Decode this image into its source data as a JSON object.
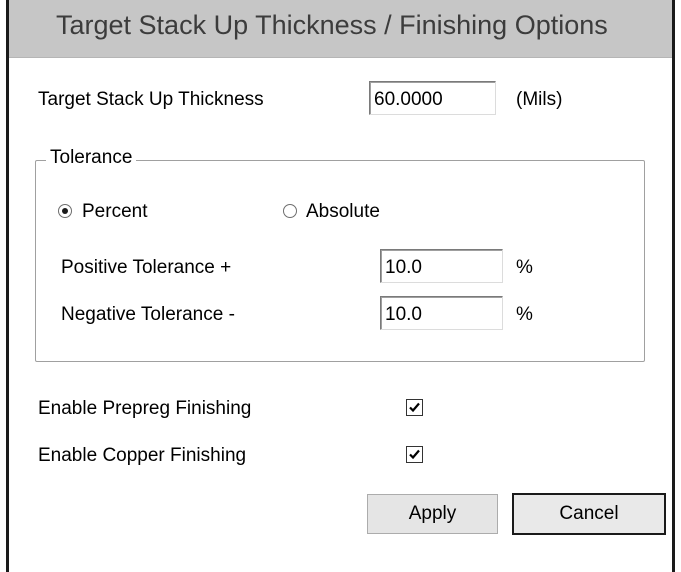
{
  "window": {
    "title": "Target Stack Up Thickness / Finishing Options"
  },
  "thickness": {
    "label": "Target Stack Up Thickness",
    "value": "60.0000",
    "unit": "(Mils)"
  },
  "tolerance": {
    "group_label": "Tolerance",
    "mode_options": [
      {
        "label": "Percent",
        "checked": true
      },
      {
        "label": "Absolute",
        "checked": false
      }
    ],
    "positive": {
      "label": "Positive Tolerance  +",
      "value": "10.0",
      "unit": "%"
    },
    "negative": {
      "label": "Negative Tolerance  -",
      "value": "10.0",
      "unit": "%"
    }
  },
  "finishing": {
    "prepreg": {
      "label": "Enable Prepreg Finishing",
      "checked": true
    },
    "copper": {
      "label": "Enable Copper Finishing",
      "checked": true
    }
  },
  "buttons": {
    "apply": "Apply",
    "cancel": "Cancel"
  },
  "icons": {
    "radio_selected": "radio-dot",
    "checkbox_check": "check-mark-icon"
  }
}
